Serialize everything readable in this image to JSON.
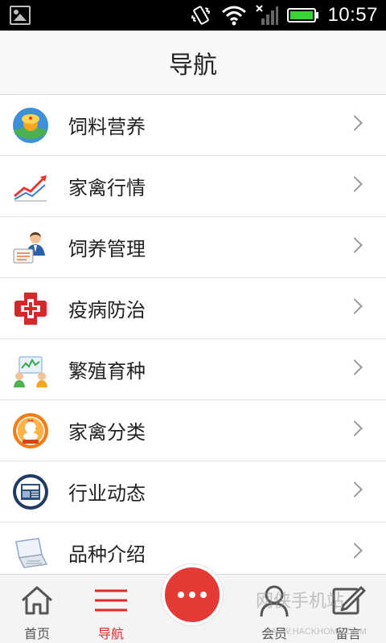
{
  "status_bar": {
    "time": "10:57"
  },
  "header": {
    "title": "导航"
  },
  "nav_list": [
    {
      "label": "饲料营养",
      "icon": "feed-nutrition-icon"
    },
    {
      "label": "家禽行情",
      "icon": "market-trend-icon"
    },
    {
      "label": "饲养管理",
      "icon": "breeding-management-icon"
    },
    {
      "label": "疫病防治",
      "icon": "disease-prevention-icon"
    },
    {
      "label": "繁殖育种",
      "icon": "reproduction-breeding-icon"
    },
    {
      "label": "家禽分类",
      "icon": "poultry-category-icon"
    },
    {
      "label": "行业动态",
      "icon": "industry-news-icon"
    },
    {
      "label": "品种介绍",
      "icon": "breed-intro-icon"
    }
  ],
  "bottom_nav": {
    "home": "首页",
    "nav": "导航",
    "member": "会员",
    "message": "留言"
  },
  "watermark": {
    "text": "网侠手机站",
    "url": "WWW.HACKHOME.COM"
  },
  "colors": {
    "accent": "#e53935",
    "active_label": "#e02a2a"
  }
}
